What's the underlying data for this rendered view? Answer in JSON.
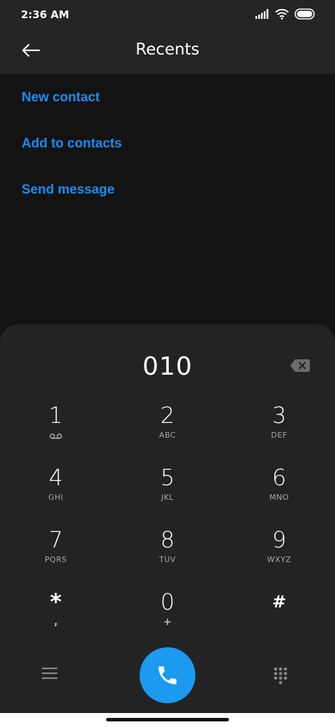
{
  "status_bar": {
    "time": "2:36 AM"
  },
  "header": {
    "title": "Recents"
  },
  "actions": [
    {
      "label": "New contact"
    },
    {
      "label": "Add to contacts"
    },
    {
      "label": "Send message"
    }
  ],
  "dialer": {
    "number": "010",
    "keys": [
      {
        "digit": "1",
        "letters": ""
      },
      {
        "digit": "2",
        "letters": "ABC"
      },
      {
        "digit": "3",
        "letters": "DEF"
      },
      {
        "digit": "4",
        "letters": "GHI"
      },
      {
        "digit": "5",
        "letters": "JKL"
      },
      {
        "digit": "6",
        "letters": "MNO"
      },
      {
        "digit": "7",
        "letters": "PQRS"
      },
      {
        "digit": "8",
        "letters": "TUV"
      },
      {
        "digit": "9",
        "letters": "WXYZ"
      },
      {
        "digit": "*",
        "letters": ","
      },
      {
        "digit": "0",
        "letters": "+"
      },
      {
        "digit": "#",
        "letters": ""
      }
    ]
  },
  "colors": {
    "accent": "#1a8cf5",
    "call_button": "#1b9af0",
    "sheet_bg": "#232323",
    "header_bg": "#252525"
  }
}
